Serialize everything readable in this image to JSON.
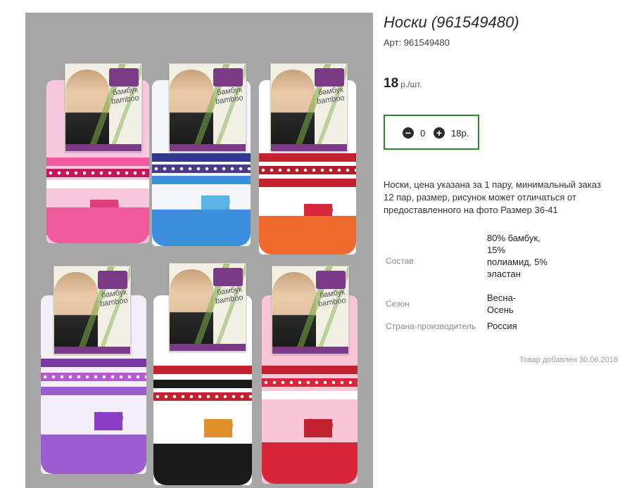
{
  "product": {
    "title": "Носки (961549480)",
    "sku_label": "Арт: 961549480",
    "price_value": "18",
    "price_unit": "р./шт.",
    "image_alt": "Носки"
  },
  "quantity": {
    "minus_icon": "minus-circle-icon",
    "plus_icon": "plus-circle-icon",
    "minus_glyph": "−",
    "plus_glyph": "+",
    "value": "0",
    "total": "18р."
  },
  "description": "Носки, цена указана за 1 пару, минимальный заказ 12 пар, размер, рисунок может отличаться от предоставленного на фото Размер 36-41",
  "specs": [
    {
      "key": "Состав",
      "value": "80% бамбук, 15% полиамид, 5% эластан"
    },
    {
      "key": "Сезон",
      "value": "Весна-Осень"
    },
    {
      "key": "Страна-производитель",
      "value": "Россия"
    }
  ],
  "added_date": "Товар добавлен 30.06.2018",
  "photo": {
    "label_texts": [
      "бамбук",
      "bamboo"
    ],
    "sock_colors": [
      "#f25a9e",
      "#3c8fdc",
      "#f06a2c",
      "#9b5ccf",
      "#1a1a1a",
      "#d8253a"
    ],
    "bg_color": "#a7a7a7",
    "accent_border": "#2a8a2a"
  }
}
